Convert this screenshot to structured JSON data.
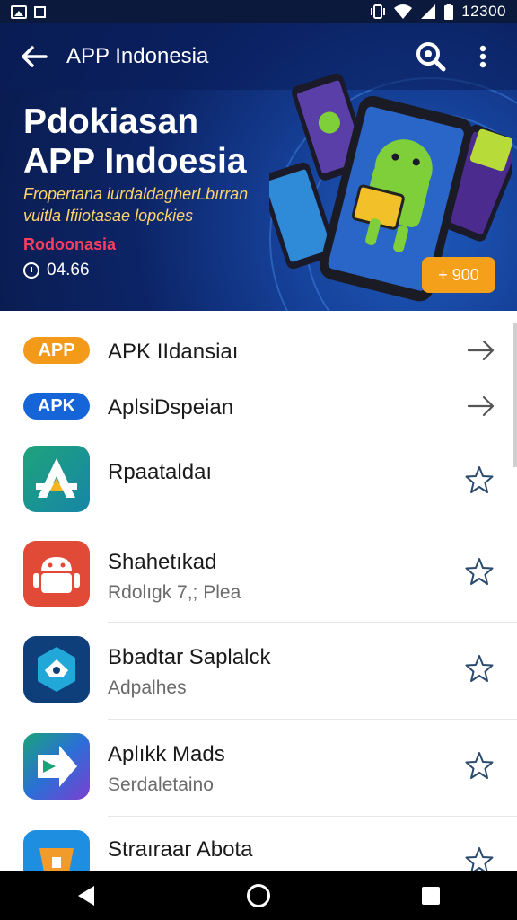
{
  "status_bar": {
    "time": "12300",
    "left_icons": [
      "photo-icon",
      "square-icon"
    ],
    "right_icons": [
      "vibrate-icon",
      "wifi-icon",
      "signal-icon",
      "battery-icon"
    ]
  },
  "toolbar": {
    "title": "APP Indonesia",
    "back_icon": "arrow-left-icon",
    "search_icon": "search-icon",
    "more_icon": "more-vert-icon"
  },
  "hero": {
    "title_line1": "Pdokiasan",
    "title_line2": "APP Indoesia",
    "subtitle_line1": "Fropertana iurdaldagherLbırran",
    "subtitle_line2": "vuitla Ifiiotasae lopckies",
    "tag": "Rodoonasia",
    "meta": "04.66",
    "badge": "+ 900",
    "colors": {
      "badge": "#f5a01a",
      "tag": "#ff3d5e",
      "subtitle": "#ffd46a"
    }
  },
  "list": {
    "short_rows": [
      {
        "pill": "APP",
        "pill_color": "#f39a1b",
        "title": "APK IIdansiaı"
      },
      {
        "pill": "APK",
        "pill_color": "#1565d8",
        "title": "AplsiDspeian"
      }
    ],
    "app_rows": [
      {
        "title": "Rpaataldaı",
        "subtitle": "",
        "icon": "app-store-a-icon"
      },
      {
        "title": "Shahetıkad",
        "subtitle": "Rdolıgk 7,; Plea",
        "icon": "android-robot-icon"
      },
      {
        "title": "Bbadtar Saplalck",
        "subtitle": "Adpalhes",
        "icon": "hexagon-bird-icon"
      },
      {
        "title": "Aplıkk Mads",
        "subtitle": "Serdaletaino",
        "icon": "play-arrow-icon"
      },
      {
        "title": "Straıraar Abota",
        "subtitle": "",
        "icon": "package-icon"
      }
    ]
  },
  "nav": {
    "back": "nav-back-icon",
    "home": "nav-home-icon",
    "recent": "nav-recent-icon"
  }
}
